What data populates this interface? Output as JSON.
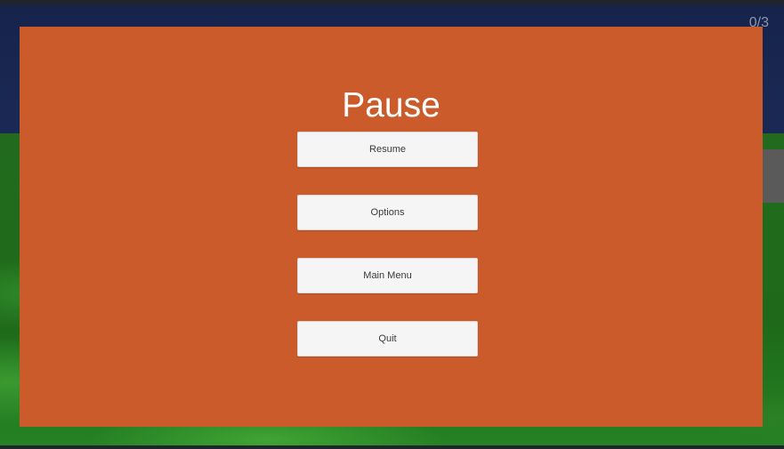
{
  "hud": {
    "collected_counter": "0/3"
  },
  "pause_menu": {
    "title": "Pause",
    "buttons": {
      "resume": "Resume",
      "options": "Options",
      "main_menu": "Main Menu",
      "quit": "Quit"
    }
  },
  "colors": {
    "panel": "#cb5b2b",
    "button": "#f5f5f5",
    "sky": "#1b2a55",
    "ground": "#226b1e"
  }
}
